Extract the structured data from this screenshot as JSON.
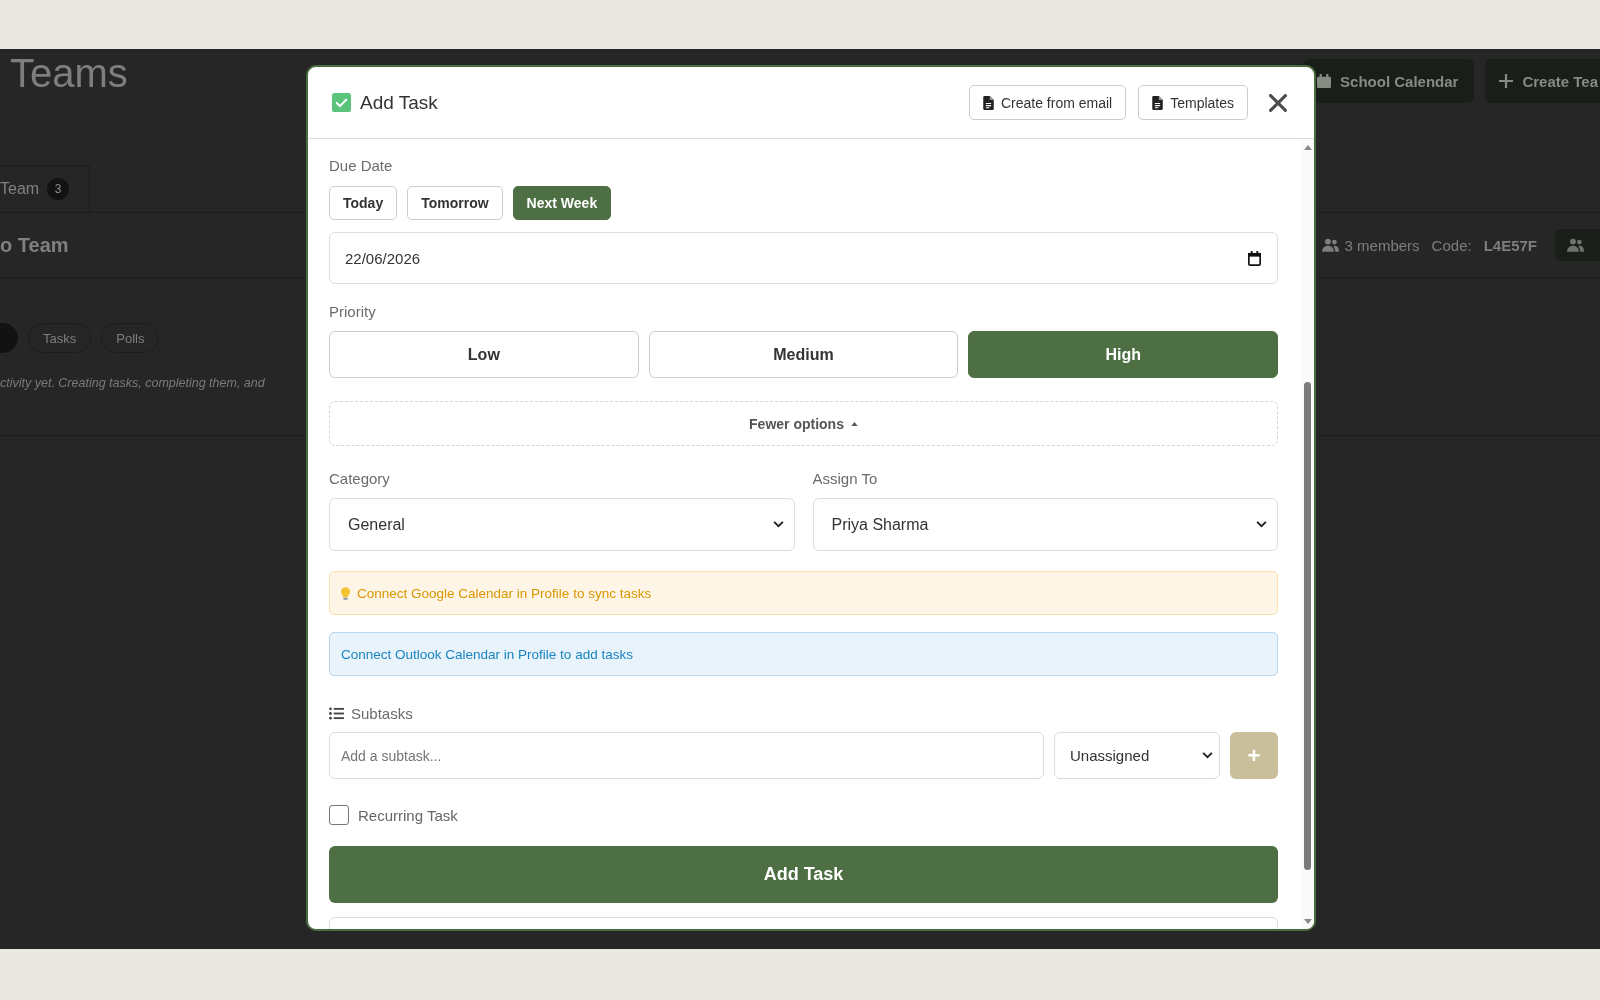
{
  "background_page": {
    "title": "Teams",
    "header_buttons": [
      {
        "kind": "calendar",
        "label": "School Calendar"
      },
      {
        "kind": "plus",
        "label": "Create Tea"
      }
    ],
    "team_tabs": [
      {
        "label": "Team",
        "badge": "3",
        "selected": true
      }
    ],
    "team": {
      "name": "o Team",
      "members": "3 members",
      "code_label": "Code:",
      "code": "L4E57F"
    },
    "view_tabs": [
      {
        "selected": true
      },
      {
        "label": "Tasks",
        "selected": false
      },
      {
        "label": "Polls",
        "selected": false
      }
    ],
    "message": "ctivity yet. Creating tasks, completing them, and"
  },
  "modal": {
    "title": "Add Task",
    "header_buttons": [
      {
        "label": "Create from email"
      },
      {
        "label": "Templates"
      }
    ],
    "due_date": {
      "label": "Due Date",
      "quick_picks": [
        {
          "label": "Today",
          "selected": false
        },
        {
          "label": "Tomorrow",
          "selected": false
        },
        {
          "label": "Next Week",
          "selected": true
        }
      ],
      "value": "22/06/2026"
    },
    "priority": {
      "label": "Priority",
      "options": [
        {
          "label": "Low",
          "selected": false
        },
        {
          "label": "Medium",
          "selected": false
        },
        {
          "label": "High",
          "selected": true
        }
      ]
    },
    "options_toggle": {
      "label": "Fewer options",
      "expanded": true
    },
    "category": {
      "label": "Category",
      "value": "General"
    },
    "assign_to": {
      "label": "Assign To",
      "value": "Priya Sharma"
    },
    "notices": [
      {
        "kind": "warning",
        "text": "Connect Google Calendar in Profile to sync tasks"
      },
      {
        "kind": "info",
        "text": "Connect Outlook Calendar in Profile to add tasks"
      }
    ],
    "subtasks": {
      "label": "Subtasks",
      "placeholder": "Add a subtask...",
      "assignee": "Unassigned",
      "add_button": {
        "label": "+",
        "disabled": true
      }
    },
    "recurring": {
      "label": "Recurring Task",
      "checked": false
    },
    "submit": "Add Task"
  }
}
